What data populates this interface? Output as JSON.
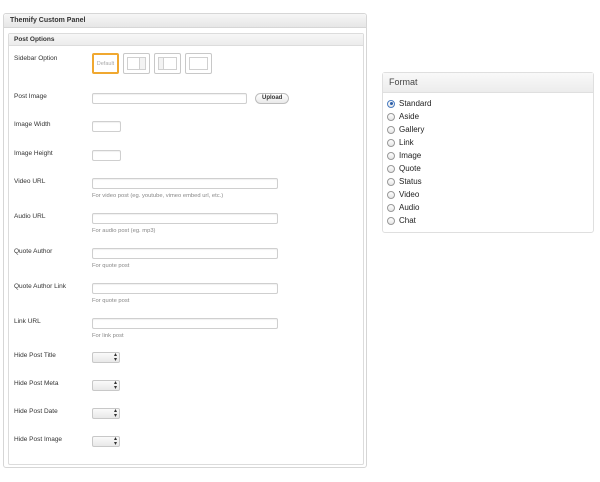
{
  "panel": {
    "title": "Themify Custom Panel",
    "section_title": "Post Options",
    "sidebar_option": {
      "label": "Sidebar Option",
      "default_label": "Default",
      "selected_index": 0,
      "accent_color": "#f0a830"
    },
    "post_image": {
      "label": "Post Image",
      "value": "",
      "upload_label": "Upload"
    },
    "image_width": {
      "label": "Image Width",
      "value": ""
    },
    "image_height": {
      "label": "Image Height",
      "value": ""
    },
    "video_url": {
      "label": "Video URL",
      "value": "",
      "hint": "For video post (eg. youtube, vimeo embed url, etc.)"
    },
    "audio_url": {
      "label": "Audio URL",
      "value": "",
      "hint": "For audio post (eg. mp3)"
    },
    "quote_author": {
      "label": "Quote Author",
      "value": "",
      "hint": "For quote post"
    },
    "quote_author_link": {
      "label": "Quote Author Link",
      "value": "",
      "hint": "For quote post"
    },
    "link_url": {
      "label": "Link URL",
      "value": "",
      "hint": "For link post"
    },
    "hide_post_title": {
      "label": "Hide Post Title",
      "value": ""
    },
    "hide_post_meta": {
      "label": "Hide Post Meta",
      "value": ""
    },
    "hide_post_date": {
      "label": "Hide Post Date",
      "value": ""
    },
    "hide_post_image": {
      "label": "Hide Post Image",
      "value": ""
    }
  },
  "format": {
    "title": "Format",
    "selected": "Standard",
    "options": [
      "Standard",
      "Aside",
      "Gallery",
      "Link",
      "Image",
      "Quote",
      "Status",
      "Video",
      "Audio",
      "Chat"
    ]
  }
}
